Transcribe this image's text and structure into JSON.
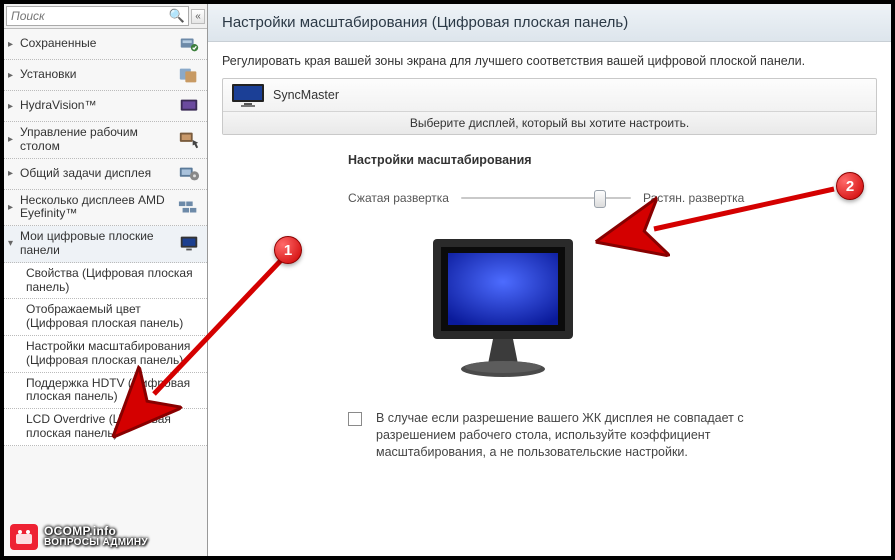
{
  "search": {
    "placeholder": "Поиск"
  },
  "sidebar": {
    "items": [
      {
        "label": "Сохраненные"
      },
      {
        "label": "Установки"
      },
      {
        "label": "HydraVision™"
      },
      {
        "label": "Управление рабочим столом"
      },
      {
        "label": "Общий задачи дисплея"
      },
      {
        "label": "Несколько дисплеев AMD Eyefinity™"
      },
      {
        "label": "Мои цифровые плоские панели"
      }
    ],
    "subs": [
      {
        "label": "Свойства (Цифровая плоская панель)"
      },
      {
        "label": "Отображаемый цвет (Цифровая плоская панель)"
      },
      {
        "label": "Настройки масштабирования (Цифровая плоская панель)"
      },
      {
        "label": "Поддержка HDTV (Цифровая плоская панель)"
      },
      {
        "label": "LCD Overdrive (Цифровая плоская панель)"
      }
    ]
  },
  "header": {
    "title": "Настройки масштабирования (Цифровая плоская панель)"
  },
  "desc": "Регулировать края вашей зоны экрана для лучшего соответствия вашей цифровой плоской панели.",
  "picker": {
    "name": "SyncMaster",
    "hint": "Выберите дисплей, который вы хотите настроить."
  },
  "section": {
    "title": "Настройки масштабирования"
  },
  "slider": {
    "left_label": "Сжатая развертка",
    "right_label": "Растян. развертка",
    "position_percent": 82
  },
  "note": {
    "checked": false,
    "text": "В случае если разрешение вашего ЖК дисплея не совпадает с разрешением рабочего стола, используйте коэффициент масштабирования, а не пользовательские настройки."
  },
  "annotations": {
    "badge1": "1",
    "badge2": "2"
  },
  "watermark": {
    "line1": "OCOMP.info",
    "line2": "ВОПРОСЫ АДМИНУ"
  }
}
